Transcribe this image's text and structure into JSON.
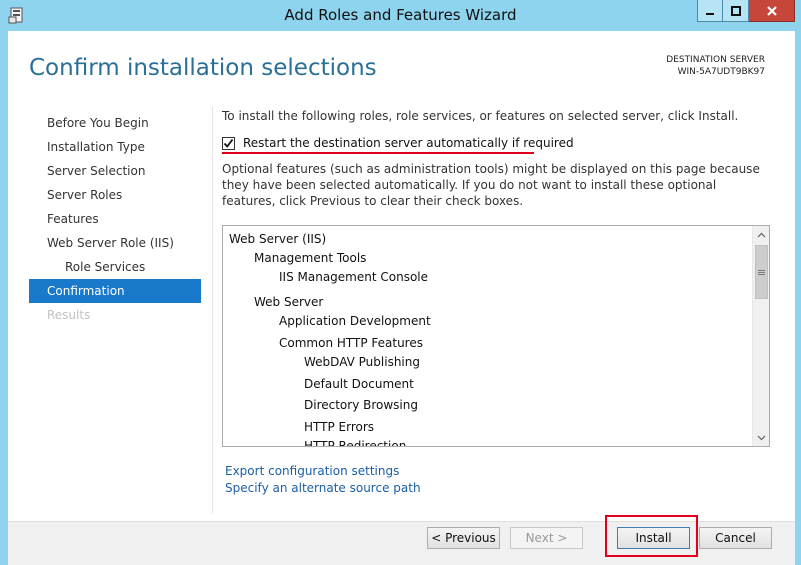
{
  "window": {
    "title": "Add Roles and Features Wizard",
    "controls": {
      "minimize": "minimize",
      "maximize": "maximize",
      "close": "close"
    },
    "frame_color": "#8fd4ef"
  },
  "header": {
    "page_title": "Confirm installation selections",
    "destination_label": "DESTINATION SERVER",
    "destination_name": "WIN-5A7UDT9BK97"
  },
  "nav": {
    "items": [
      {
        "label": "Before You Begin",
        "state": "normal"
      },
      {
        "label": "Installation Type",
        "state": "normal"
      },
      {
        "label": "Server Selection",
        "state": "normal"
      },
      {
        "label": "Server Roles",
        "state": "normal"
      },
      {
        "label": "Features",
        "state": "normal"
      },
      {
        "label": "Web Server Role (IIS)",
        "state": "normal"
      },
      {
        "label": "Role Services",
        "state": "normal"
      },
      {
        "label": "Confirmation",
        "state": "active"
      },
      {
        "label": "Results",
        "state": "disabled"
      }
    ]
  },
  "content": {
    "intro": "To install the following roles, role services, or features on selected server, click Install.",
    "restart_checkbox": {
      "label": "Restart the destination server automatically if required",
      "checked": true
    },
    "optional_text": "Optional features (such as administration tools) might be displayed on this page because they have been selected automatically. If you do not want to install these optional features, click Previous to clear their check boxes.",
    "tree": [
      {
        "label": "Web Server (IIS)",
        "level": 0
      },
      {
        "label": "Management Tools",
        "level": 1
      },
      {
        "label": "IIS Management Console",
        "level": 2
      },
      {
        "label": "Web Server",
        "level": 1
      },
      {
        "label": "Application Development",
        "level": 2
      },
      {
        "label": "Common HTTP Features",
        "level": 2
      },
      {
        "label": "WebDAV Publishing",
        "level": 3
      },
      {
        "label": "Default Document",
        "level": 3
      },
      {
        "label": "Directory Browsing",
        "level": 3
      },
      {
        "label": "HTTP Errors",
        "level": 3
      },
      {
        "label": "HTTP Redirection",
        "level": 3
      }
    ],
    "links": {
      "export": "Export configuration settings",
      "alternate_source": "Specify an alternate source path"
    }
  },
  "buttons": {
    "previous": "< Previous",
    "next": "Next >",
    "install": "Install",
    "cancel": "Cancel"
  },
  "annotations": {
    "highlight_color": "#e0001b"
  },
  "colors": {
    "title_blue": "#2a6f97",
    "nav_active": "#1979ca",
    "link": "#1a5fa5"
  }
}
